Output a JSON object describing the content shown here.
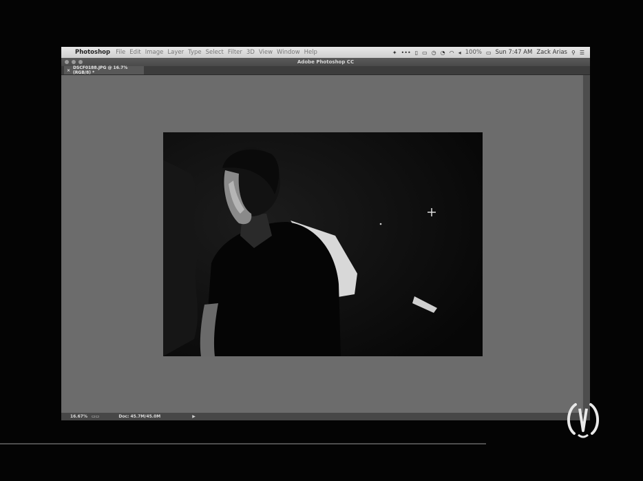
{
  "menubar": {
    "app_name": "Photoshop",
    "menus": [
      "File",
      "Edit",
      "Image",
      "Layer",
      "Type",
      "Select",
      "Filter",
      "3D",
      "View",
      "Window",
      "Help"
    ],
    "battery": "100%",
    "clock": "Sun 7:47 AM",
    "user": "Zack Arias"
  },
  "window": {
    "title": "Adobe Photoshop CC"
  },
  "document": {
    "tab_label": "DSCF0188.JPG @ 16.7% (RGB/8) *",
    "close_glyph": "×"
  },
  "statusbar": {
    "zoom": "16.67%",
    "doc_info": "Doc: 45.7M/45.0M",
    "arrow": "▶"
  },
  "colors": {
    "workspace": "#6c6c6c",
    "menubar": "#d8d8d8"
  }
}
